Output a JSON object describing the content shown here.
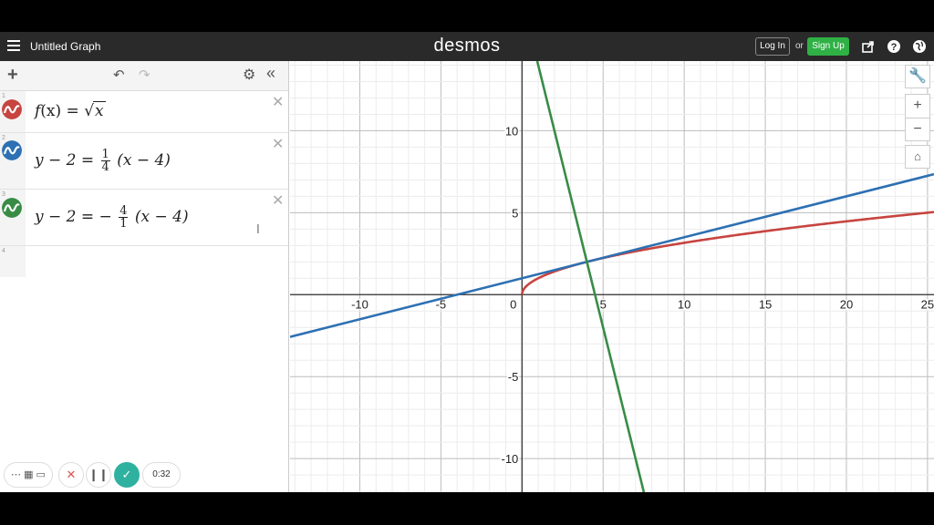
{
  "header": {
    "title": "Untitled Graph",
    "logo": "desmos",
    "login_label": "Log In",
    "or_label": "or",
    "signup_label": "Sign Up"
  },
  "expressions": [
    {
      "num": "1",
      "color": "#c74440",
      "latex_parts": [
        "f",
        "(x) = ",
        "x"
      ]
    },
    {
      "num": "2",
      "color": "#2d70b3",
      "lhs": "y − 2 =",
      "frac_num": "1",
      "frac_den": "4",
      "rhs": "(x − 4)"
    },
    {
      "num": "3",
      "color": "#388c46",
      "lhs": "y − 2 = −",
      "frac_num": "4",
      "frac_den": "1",
      "rhs": "(x − 4)"
    },
    {
      "num": "4"
    }
  ],
  "graph": {
    "x_ticks": [
      "-10",
      "-5",
      "0",
      "5",
      "10",
      "15",
      "20",
      "25"
    ],
    "y_ticks": [
      "10",
      "5",
      "-5",
      "-10"
    ],
    "xlim": [
      -14.3,
      25.4
    ],
    "ylim": [
      -12.05,
      14.25
    ],
    "curves": [
      {
        "name": "f(x) = √x",
        "color": "#c74440"
      },
      {
        "name": "y − 2 = 1/4 (x − 4)",
        "color": "#2d70b3"
      },
      {
        "name": "y − 2 = −4/1 (x − 4)",
        "color": "#388c46"
      }
    ]
  },
  "recorder": {
    "time": "0:32"
  }
}
